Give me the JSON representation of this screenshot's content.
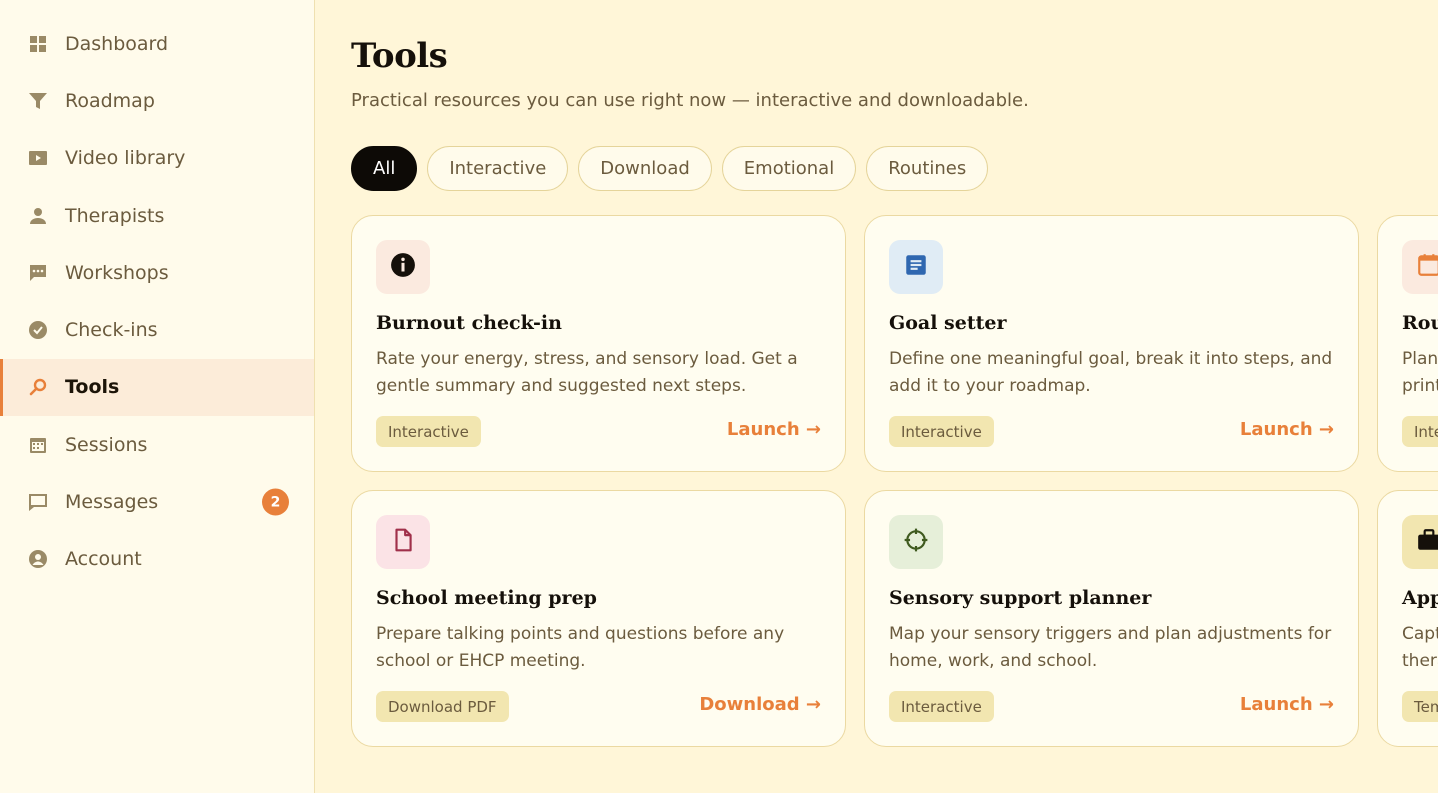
{
  "sidebar": {
    "items": [
      {
        "label": "Dashboard",
        "icon": "grid-icon"
      },
      {
        "label": "Roadmap",
        "icon": "filter-icon"
      },
      {
        "label": "Video library",
        "icon": "play-icon"
      },
      {
        "label": "Therapists",
        "icon": "person-icon"
      },
      {
        "label": "Workshops",
        "icon": "chat-dots-icon"
      },
      {
        "label": "Check-ins",
        "icon": "check-circle-icon"
      },
      {
        "label": "Tools",
        "icon": "search-icon"
      },
      {
        "label": "Sessions",
        "icon": "calendar-icon"
      },
      {
        "label": "Messages",
        "icon": "message-icon",
        "badge": "2"
      },
      {
        "label": "Account",
        "icon": "account-icon"
      }
    ],
    "active": "Tools"
  },
  "header": {
    "title": "Tools",
    "subtitle": "Practical resources you can use right now — interactive and downloadable."
  },
  "filters": [
    "All",
    "Interactive",
    "Download",
    "Emotional",
    "Routines"
  ],
  "active_filter": "All",
  "cards": [
    {
      "title": "Burnout check-in",
      "description": "Rate your energy, stress, and sensory load. Get a gentle summary and suggested next steps.",
      "tag": "Interactive",
      "action": "Launch →",
      "icon": "info-icon",
      "tile_color": "#fbeadf",
      "icon_color": "#15100a"
    },
    {
      "title": "Goal setter",
      "description": "Define one meaningful goal, break it into steps, and add it to your roadmap.",
      "tag": "Interactive",
      "action": "Launch →",
      "icon": "document-text-icon",
      "tile_color": "#e0ecf5",
      "icon_color": "#2f67b0"
    },
    {
      "title": "Rou",
      "description": "Plan\nprint",
      "tag": "Inte",
      "action": "",
      "icon": "calendar-icon",
      "tile_color": "#fbeadf",
      "icon_color": "#e8803a"
    },
    {
      "title": "School meeting prep",
      "description": "Prepare talking points and questions before any school or EHCP meeting.",
      "tag": "Download PDF",
      "action": "Download →",
      "icon": "file-icon",
      "tile_color": "#fbe3e6",
      "icon_color": "#a0304a"
    },
    {
      "title": "Sensory support planner",
      "description": "Map your sensory triggers and plan adjustments for home, work, and school.",
      "tag": "Interactive",
      "action": "Launch →",
      "icon": "target-icon",
      "tile_color": "#e6efd9",
      "icon_color": "#3f5a1f"
    },
    {
      "title": "App",
      "description": "Capt\nthera",
      "tag": "Tem",
      "action": "",
      "icon": "briefcase-icon",
      "tile_color": "#f2e6b0",
      "icon_color": "#15100a"
    }
  ],
  "colors": {
    "accent": "#e8803a",
    "background": "#fff6d8",
    "sidebar_bg": "#fffbeb",
    "active_filter_bg": "#0d0a06"
  }
}
